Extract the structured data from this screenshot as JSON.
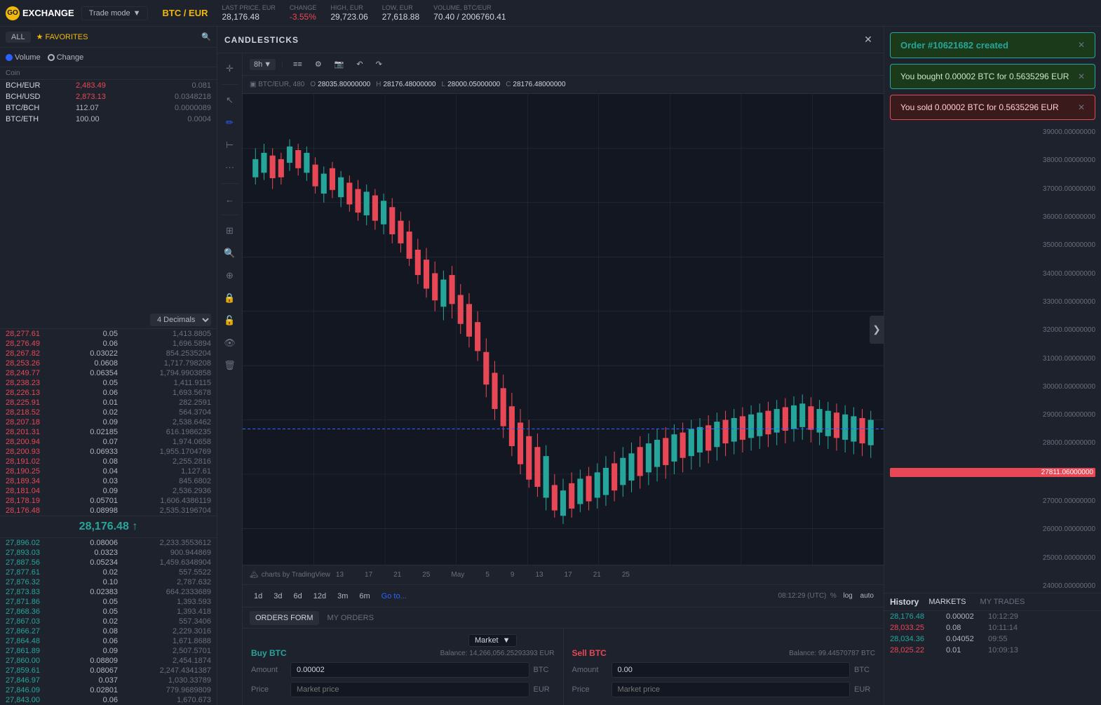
{
  "app": {
    "logo": "GO",
    "name": "EXCHANGE"
  },
  "topbar": {
    "trade_mode_label": "Trade mode",
    "pair": "BTC / EUR",
    "last_price_label": "Last price, EUR",
    "last_price": "28,176.48",
    "change_label": "Change",
    "change": "-3.55%",
    "high_label": "High, EUR",
    "high": "29,723.06",
    "low_label": "Low, EUR",
    "low": "27,618.88",
    "volume_label": "Volume, BTC/EUR",
    "volume": "70.40 / 2006760.41"
  },
  "sidebar": {
    "all_label": "ALL",
    "favorites_label": "★ FAVORITES",
    "volume_label": "Volume",
    "change_label": "Change",
    "coin_header": "Coin",
    "decimals_label": "4 Decimals",
    "coins": [
      {
        "name": "BCH/EUR",
        "price": "2,483.49",
        "change": "0.081",
        "color": "red"
      },
      {
        "name": "BCH/USD",
        "price": "2,873.13",
        "change": "0.0348218",
        "color": "red"
      },
      {
        "name": "BTC/BCH",
        "price": "112.07",
        "change": "0.0000089",
        "color": ""
      },
      {
        "name": "BTC/ETH",
        "price": "100.00",
        "change": "0.0004",
        "color": ""
      }
    ],
    "asks": [
      {
        "price": "28,277.61",
        "amount": "0.05",
        "total": "1,413.8805"
      },
      {
        "price": "28,276.49",
        "amount": "0.06",
        "total": "1,696.5894"
      },
      {
        "price": "28,267.82",
        "amount": "0.03022",
        "total": "854.2535204"
      },
      {
        "price": "28,253.26",
        "amount": "0.0608",
        "total": "1,717.798208"
      },
      {
        "price": "28,249.77",
        "amount": "0.06354",
        "total": "1,794.9903858"
      },
      {
        "price": "28,238.23",
        "amount": "0.05",
        "total": "1,411.9115"
      },
      {
        "price": "28,226.13",
        "amount": "0.06",
        "total": "1,693.5678"
      },
      {
        "price": "28,225.91",
        "amount": "0.01",
        "total": "282.2591"
      },
      {
        "price": "28,218.52",
        "amount": "0.02",
        "total": "564.3704"
      },
      {
        "price": "28,207.18",
        "amount": "0.09",
        "total": "2,538.6462"
      },
      {
        "price": "28,201.31",
        "amount": "0.02185",
        "total": "616.1986235"
      },
      {
        "price": "28,200.94",
        "amount": "0.07",
        "total": "1,974.0658"
      },
      {
        "price": "28,200.93",
        "amount": "0.06933",
        "total": "1,955.1704769"
      },
      {
        "price": "28,191.02",
        "amount": "0.08",
        "total": "2,255.2816"
      },
      {
        "price": "28,190.25",
        "amount": "0.04",
        "total": "1,127.61"
      },
      {
        "price": "28,189.34",
        "amount": "0.03",
        "total": "845.6802"
      },
      {
        "price": "28,181.04",
        "amount": "0.09",
        "total": "2,536.2936"
      },
      {
        "price": "28,178.19",
        "amount": "0.05701",
        "total": "1,606.4386119"
      },
      {
        "price": "28,176.48",
        "amount": "0.08998",
        "total": "2,535.3196704"
      }
    ],
    "current_price": "28,176.48",
    "bids": [
      {
        "price": "27,896.02",
        "amount": "0.08006",
        "total": "2,233.3553612"
      },
      {
        "price": "27,893.03",
        "amount": "0.0323",
        "total": "900.944869"
      },
      {
        "price": "27,887.56",
        "amount": "0.05234",
        "total": "1,459.6348904"
      },
      {
        "price": "27,877.61",
        "amount": "0.02",
        "total": "557.5522"
      },
      {
        "price": "27,876.32",
        "amount": "0.10",
        "total": "2,787.632"
      },
      {
        "price": "27,873.83",
        "amount": "0.02383",
        "total": "664.2333689"
      },
      {
        "price": "27,871.86",
        "amount": "0.05",
        "total": "1,393.593"
      },
      {
        "price": "27,868.36",
        "amount": "0.05",
        "total": "1,393.418"
      },
      {
        "price": "27,867.03",
        "amount": "0.02",
        "total": "557.3406"
      },
      {
        "price": "27,866.27",
        "amount": "0.08",
        "total": "2,229.3016"
      },
      {
        "price": "27,864.48",
        "amount": "0.06",
        "total": "1,671.8688"
      },
      {
        "price": "27,861.89",
        "amount": "0.09",
        "total": "2,507.5701"
      },
      {
        "price": "27,860.00",
        "amount": "0.08809",
        "total": "2,454.1874"
      },
      {
        "price": "27,859.61",
        "amount": "0.08067",
        "total": "2,247.4341387"
      },
      {
        "price": "27,846.97",
        "amount": "0.037",
        "total": "1,030.33789"
      },
      {
        "price": "27,846.09",
        "amount": "0.02801",
        "total": "779.9689809"
      },
      {
        "price": "27,843.00",
        "amount": "0.06",
        "total": "1,670.673"
      }
    ]
  },
  "chart": {
    "title": "CANDLESTICKS",
    "pair_label": "BTC/EUR, 480",
    "timeframe": "8h",
    "ohlc": {
      "open_label": "O",
      "open": "28035.80000000",
      "high_label": "H",
      "high": "28176.48000000",
      "low_label": "L",
      "low": "28000.05000000",
      "close_label": "C",
      "close": "28176.48000000"
    },
    "timeframes": [
      "1d",
      "3d",
      "6d",
      "12d",
      "3m",
      "6m",
      "Go to..."
    ],
    "timestamp": "08:12:29 (UTC)",
    "log_label": "log",
    "auto_label": "auto",
    "dates": [
      "13",
      "17",
      "21",
      "25",
      "May",
      "5",
      "9",
      "13",
      "17",
      "21",
      "25"
    ],
    "tradingview_label": "charts by TradingView",
    "price_levels": [
      "39000.00000000",
      "38000.00000000",
      "37000.00000000",
      "36000.00000000",
      "35000.00000000",
      "34000.00000000",
      "33000.00000000",
      "32000.00000000",
      "31000.00000000",
      "30000.00000000",
      "29000.00000000",
      "28000.00000000",
      "27811.06000000",
      "27000.00000000",
      "26000.00000000",
      "25000.00000000",
      "24000.00000000"
    ],
    "current_price_level": "27811.06000000"
  },
  "order_entry": {
    "market_type": "Market",
    "buy_label": "Buy BTC",
    "buy_balance_label": "Balance:",
    "buy_balance": "14,266,056.25293393 EUR",
    "buy_amount_label": "Amount",
    "buy_amount": "0.00002",
    "buy_amount_currency": "BTC",
    "buy_price_label": "Price",
    "buy_price_placeholder": "Market price",
    "buy_price_currency": "EUR",
    "sell_label": "Sell BTC",
    "sell_balance_label": "Balance:",
    "sell_balance": "99.44570787 BTC",
    "sell_amount_label": "Amount",
    "sell_amount": "0.00",
    "sell_amount_currency": "BTC",
    "sell_price_label": "Price",
    "sell_price_placeholder": "Market price",
    "sell_price_currency": "EUR"
  },
  "bottom_tabs": {
    "orders_form_label": "ORDERS FORM",
    "my_orders_label": "MY ORDERS"
  },
  "history": {
    "title": "History",
    "markets_label": "MARKETS",
    "my_trades_label": "MY TRADES",
    "rows": [
      {
        "price": "28,176.48",
        "amount": "0.00002",
        "time": "10:12:29",
        "color": "green"
      },
      {
        "price": "28,033.25",
        "amount": "0.08",
        "time": "10:11:14",
        "color": "red"
      },
      {
        "price": "28,034.36",
        "amount": "0.04052",
        "time": "09:55",
        "color": "green"
      },
      {
        "price": "28,025.22",
        "amount": "0.01",
        "time": "10:09:13",
        "color": "red"
      }
    ]
  },
  "notifications": {
    "order_created": "Order #10621682 created",
    "bought_text": "You bought 0.00002 BTC for 0.5635296 EUR",
    "sold_text": "You sold 0.00002 BTC for 0.5635296 EUR"
  },
  "icons": {
    "crosshair": "✛",
    "cursor": "↖",
    "pencil": "✏",
    "ruler": "⊢",
    "magnet": "⊕",
    "eye": "👁",
    "trash": "🗑",
    "zoom": "⊕",
    "fibonacci": "⁽",
    "back": "←",
    "lock": "🔒",
    "lock_open": "🔓",
    "chevron": "▼",
    "chevron_right": "▶",
    "expand": "❯",
    "candle_icon": "📊",
    "settings": "⚙",
    "photo": "📷",
    "undo": "↶",
    "redo": "↷"
  }
}
